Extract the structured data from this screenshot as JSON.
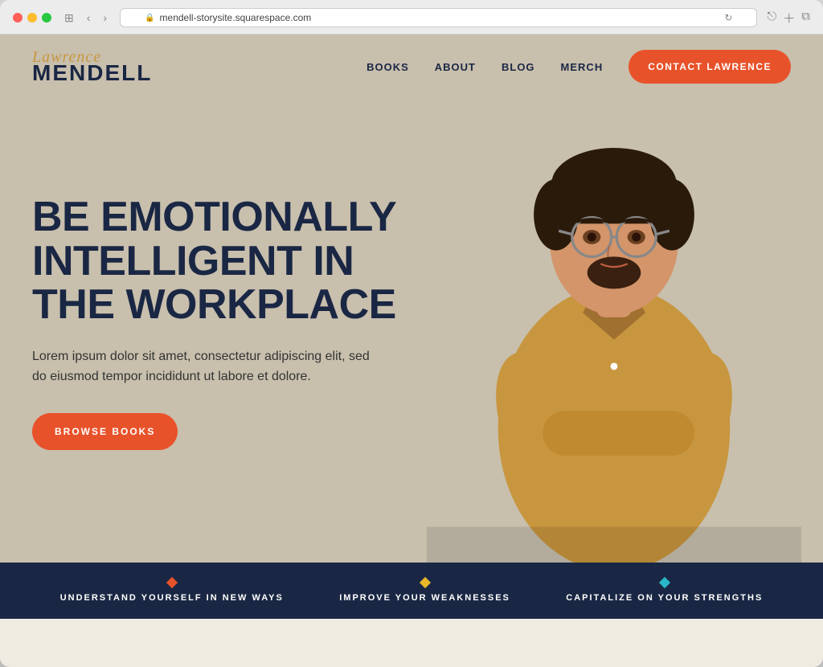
{
  "browser": {
    "url": "mendell-storysite.squarespace.com",
    "reload_label": "↻"
  },
  "nav": {
    "logo_script": "Lawrence",
    "logo_main": "MENDELL",
    "links": [
      {
        "id": "books",
        "label": "BOOKS"
      },
      {
        "id": "about",
        "label": "ABOUT"
      },
      {
        "id": "blog",
        "label": "BLOG"
      },
      {
        "id": "merch",
        "label": "MERCH"
      }
    ],
    "contact_button": "CONTACT LAWRENCE"
  },
  "hero": {
    "title": "BE EMOTIONALLY INTELLIGENT IN THE WORKPLACE",
    "subtitle": "Lorem ipsum dolor sit amet, consectetur adipiscing elit, sed do eiusmod tempor incididunt ut labore et dolore.",
    "browse_button": "BROWSE BOOKS"
  },
  "bottom_bar": {
    "items": [
      {
        "id": "understand",
        "label": "UNDERSTAND YOURSELF IN NEW WAYS",
        "diamond_class": "diamond-orange"
      },
      {
        "id": "improve",
        "label": "IMPROVE YOUR WEAKNESSES",
        "diamond_class": "diamond-yellow"
      },
      {
        "id": "capitalize",
        "label": "CAPITALIZE ON YOUR STRENGTHS",
        "diamond_class": "diamond-teal"
      }
    ]
  }
}
